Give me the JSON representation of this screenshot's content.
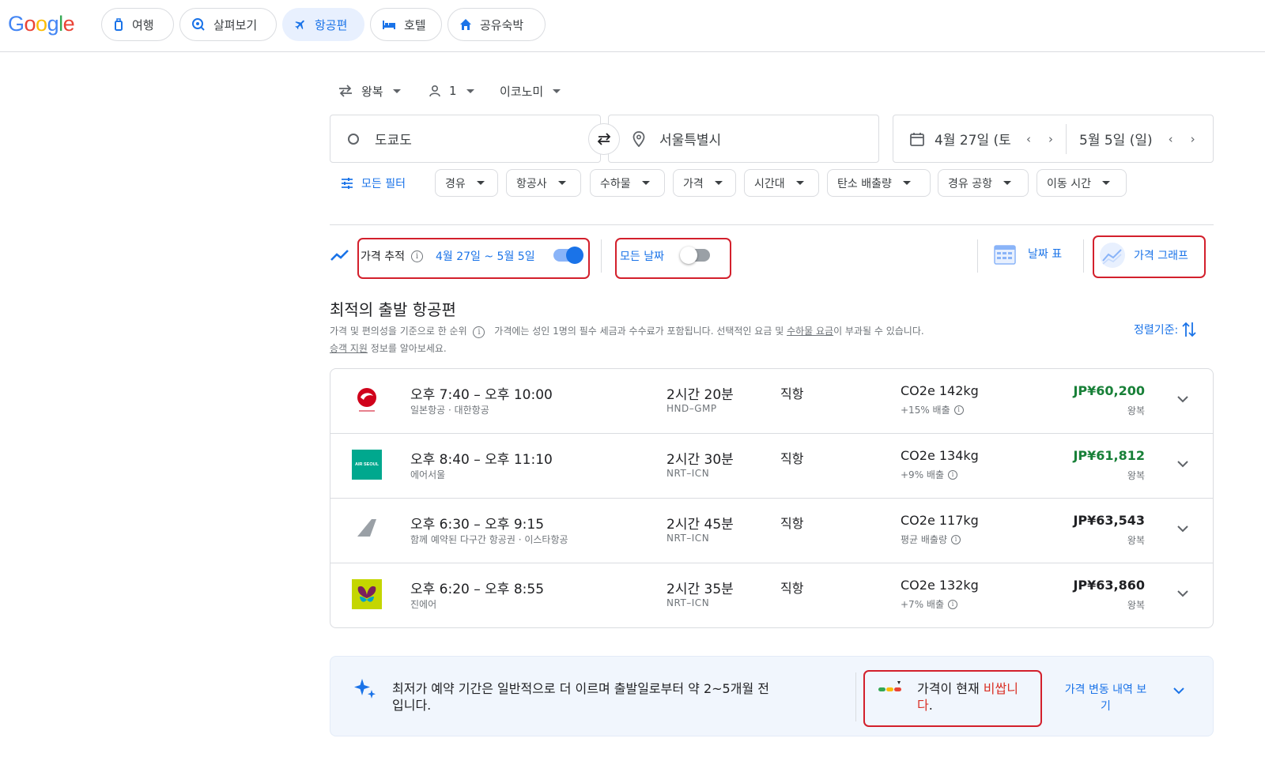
{
  "brand": {
    "logo_text": "Google"
  },
  "nav_tabs": [
    {
      "label": "여행",
      "icon": "luggage-icon"
    },
    {
      "label": "살펴보기",
      "icon": "explore-icon"
    },
    {
      "label": "항공편",
      "icon": "flight-icon",
      "active": true
    },
    {
      "label": "호텔",
      "icon": "hotel-bed-icon"
    },
    {
      "label": "공유숙박",
      "icon": "home-icon"
    }
  ],
  "search": {
    "trip_type": "왕복",
    "passengers": "1",
    "cabin_class": "이코노미",
    "origin": "도쿄도",
    "destination": "서울특별시",
    "depart_date": "4월 27일 (토)",
    "return_date": "5월 5일 (일)"
  },
  "filters": {
    "all_filters_label": "모든 필터",
    "chips": [
      "경유",
      "항공사",
      "수하물",
      "가격",
      "시간대",
      "탄소 배출량",
      "경유 공항",
      "이동 시간"
    ]
  },
  "tracking": {
    "price_tracking_label": "가격 추적",
    "tracking_range": "4월 27일 ~ 5월 5일",
    "tracking_enabled": true,
    "any_dates_label": "모든 날짜",
    "any_dates_enabled": false,
    "date_grid_label": "날짜 표",
    "price_graph_label": "가격 그래프"
  },
  "results_header": {
    "title": "최적의 출발 항공편",
    "ranking_note": "가격 및 편의성을 기준으로 한 순위",
    "fee_note_a": "가격에는 성인 1명의 필수 세금과 수수료가 포함됩니다. 선택적인 요금 및 ",
    "fee_note_link": "수하물 요금",
    "fee_note_b": "이 부과될 수 있습니다.",
    "assist_link": "승객 지원",
    "assist_note": " 정보를 알아보세요.",
    "sort_label": "정렬기준:"
  },
  "flights": [
    {
      "times": "오후 7:40 – 오후 10:00",
      "airline": "일본항공 · 대한항공",
      "duration": "2시간 20분",
      "route": "HND–GMP",
      "stops": "직항",
      "co2": "CO2e 142kg",
      "emissions": "+15% 배출",
      "price": "JP¥60,200",
      "price_type": "왕복",
      "price_color": "#188038",
      "logo": "jal-logo"
    },
    {
      "times": "오후 8:40 – 오후 11:10",
      "airline": "에어서울",
      "duration": "2시간 30분",
      "route": "NRT–ICN",
      "stops": "직항",
      "co2": "CO2e 134kg",
      "emissions": "+9% 배출",
      "price": "JP¥61,812",
      "price_type": "왕복",
      "price_color": "#188038",
      "logo": "air-seoul-logo",
      "logo_text": "AIR SEOUL"
    },
    {
      "times": "오후 6:30 – 오후 9:15",
      "airline": "함께 예약된 다구간 항공권 · 이스타항공",
      "duration": "2시간 45분",
      "route": "NRT–ICN",
      "stops": "직항",
      "co2": "CO2e 117kg",
      "emissions": "평균 배출량",
      "price": "JP¥63,543",
      "price_type": "왕복",
      "price_color": "#202124",
      "logo": "tail-fin-logo"
    },
    {
      "times": "오후 6:20 – 오후 8:55",
      "airline": "진에어",
      "duration": "2시간 35분",
      "route": "NRT–ICN",
      "stops": "직항",
      "co2": "CO2e 132kg",
      "emissions": "+7% 배출",
      "price": "JP¥63,860",
      "price_type": "왕복",
      "price_color": "#202124",
      "logo": "jin-air-logo"
    }
  ],
  "insight": {
    "booking_tip_line1": "최저가 예약 기간은 일반적으로 더 이르며 출발일로부터 약 2~5개월 전",
    "booking_tip_line2": "입니다.",
    "price_status_prefix": "가격이 현재 ",
    "price_status_value_line1": "비쌉니",
    "price_status_value_line2": "다",
    "price_status_suffix": ".",
    "history_link_line1": "가격 변동 내역 보",
    "history_link_line2": "기"
  },
  "colors": {
    "accent": "#1a73e8",
    "alert": "#d3202c",
    "good_price": "#188038"
  }
}
